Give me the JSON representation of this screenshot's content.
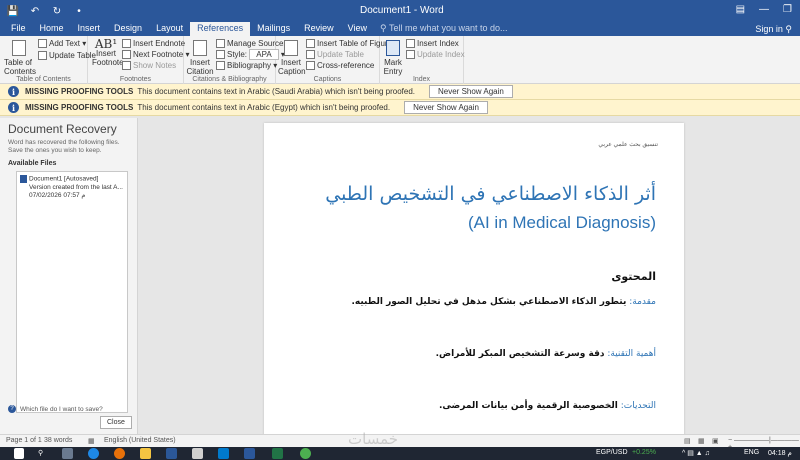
{
  "window": {
    "title": "Document1 - Word",
    "signin": "Sign in",
    "icons": [
      "save-icon",
      "undo-icon",
      "redo-icon",
      "customize-icon"
    ]
  },
  "menu": {
    "tabs": [
      "File",
      "Home",
      "Insert",
      "Design",
      "Layout",
      "References",
      "Mailings",
      "Review",
      "View"
    ],
    "active": "References",
    "tellme": "Tell me what you want to do..."
  },
  "ribbon": {
    "toc": {
      "label": "Table of Contents",
      "add_text": "Add Text",
      "update_table": "Update Table",
      "group": "Table of Contents"
    },
    "footnotes": {
      "insert_footnote": "Insert Footnote",
      "insert_endnote": "Insert Endnote",
      "next_footnote": "Next Footnote",
      "show_notes": "Show Notes",
      "group": "Footnotes"
    },
    "citations": {
      "insert_citation": "Insert Citation",
      "manage_sources": "Manage Sources",
      "style_label": "Style:",
      "style_value": "APA",
      "bibliography": "Bibliography",
      "group": "Citations & Bibliography"
    },
    "captions": {
      "insert_caption": "Insert Caption",
      "insert_tof": "Insert Table of Figures",
      "update_table": "Update Table",
      "cross_reference": "Cross-reference",
      "group": "Captions"
    },
    "index": {
      "mark_entry": "Mark Entry",
      "insert_index": "Insert Index",
      "update_index": "Update Index",
      "group": "Index"
    }
  },
  "infobars": [
    {
      "title": "MISSING PROOFING TOOLS",
      "message": "This document contains text in Arabic (Saudi Arabia) which isn't being proofed.",
      "button": "Never Show Again"
    },
    {
      "title": "MISSING PROOFING TOOLS",
      "message": "This document contains text in Arabic (Egypt) which isn't being proofed.",
      "button": "Never Show Again"
    }
  ],
  "recovery": {
    "title": "Document Recovery",
    "description": "Word has recovered the following files. Save the ones you wish to keep.",
    "available": "Available Files",
    "file_name": "Document1 [Autosaved]",
    "file_desc": "Version created from the last A...",
    "file_date": "07/02/2026 07:57 م",
    "help": "Which file do I want to save?",
    "close": "Close"
  },
  "document": {
    "header": "تنسيق بحث علمي عربي",
    "title_ar": "أثر الذكاء الاصطناعي في التشخيص الطبي",
    "title_en": "(AI in Medical Diagnosis)",
    "contents_heading": "المحتوى",
    "items": [
      {
        "label": "مقدمة:",
        "text": "يتطور الذكاء الاصطناعي بشكل مذهل في تحليل الصور الطبيه."
      },
      {
        "label": "أهمية التقنية:",
        "text": "دقة وسرعة التشخيص المبكر للأمراض."
      },
      {
        "label": "التحديات:",
        "text": "الخصوصية الرقمية وأمن بيانات المرضى."
      }
    ]
  },
  "status": {
    "page": "Page 1 of 1",
    "words": "38 words",
    "language": "English (United States)",
    "zoom_symbols": "− —————|———— +"
  },
  "taskbar": {
    "currency": "EGP/USD",
    "change": "+0.25%",
    "lang": "ENG",
    "time": "04:18 م"
  },
  "watermark": "خمسات"
}
